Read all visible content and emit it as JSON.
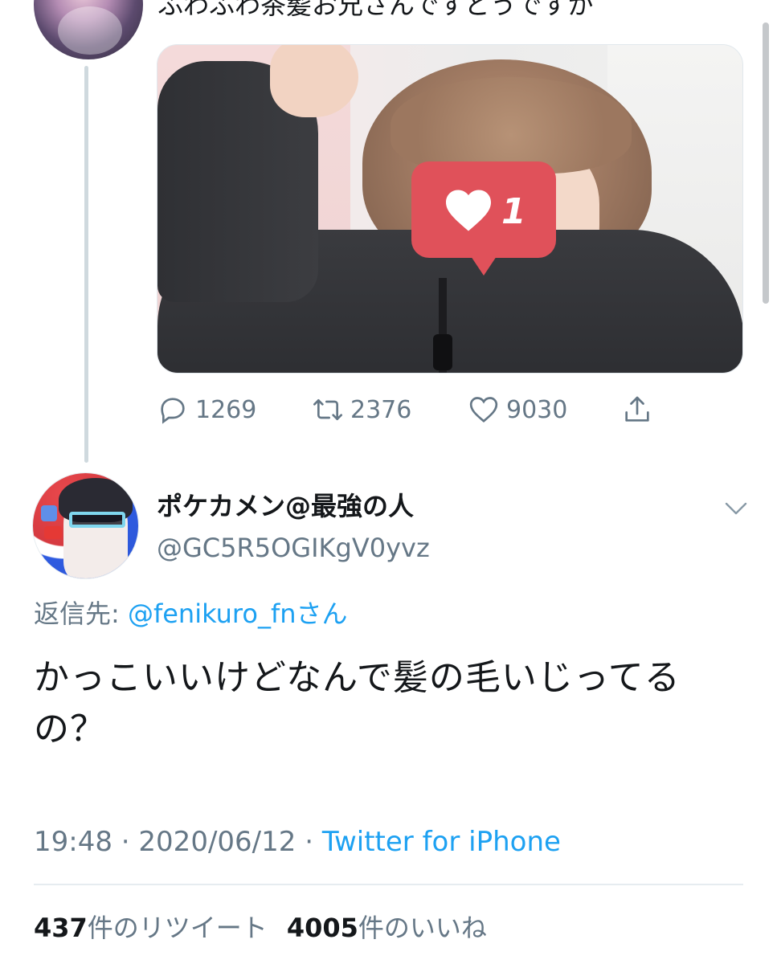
{
  "parent_tweet": {
    "text": "ふわふわ茶髪お兄さんですどうですか",
    "media": {
      "sticker_count": "1"
    },
    "actions": {
      "reply_count": "1269",
      "retweet_count": "2376",
      "like_count": "9030"
    }
  },
  "main_tweet": {
    "display_name": "ポケカメン@最強の人",
    "handle": "@GC5R5OGIKgV0yvz",
    "reply_to_label": "返信先: ",
    "reply_to_mention": "@fenikuro_fn",
    "reply_to_suffix": "さん",
    "text": "かっこいいけどなんで髪の毛いじってるの？",
    "time": "19:48",
    "separator": " · ",
    "date": "2020/06/12",
    "source": "Twitter for iPhone",
    "retweets_count": "437",
    "retweets_label": "件のリツイート",
    "likes_count": "4005",
    "likes_label": "件のいいね"
  },
  "colors": {
    "accent": "#1da1f2",
    "muted": "#657786",
    "text": "#14171a",
    "sticker": "#e0515a"
  },
  "icons": [
    "reply-icon",
    "retweet-icon",
    "like-icon",
    "share-icon",
    "chevron-down-icon",
    "heart-icon"
  ]
}
